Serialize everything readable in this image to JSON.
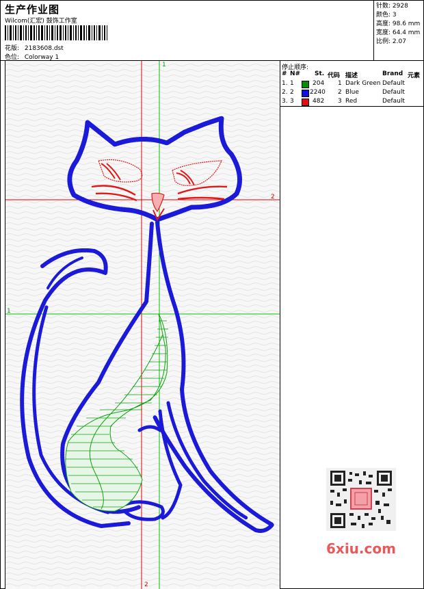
{
  "header": {
    "title": "生产作业图",
    "company": "Wilcom(汇宏) 鼓饰工作室",
    "design_label": "花版:",
    "design_value": "2183608.dst",
    "colorway_label": "色位:",
    "colorway_value": "Colorway 1"
  },
  "stats": {
    "stitches": "针数: 2928",
    "colors": "颜色: 3",
    "height": "高度: 98.6 mm",
    "width": "宽度: 64.4 mm",
    "scale": "比例: 2.07"
  },
  "guides": {
    "v1_label": "1",
    "v2_label": "2",
    "h1_label": "1",
    "h2_label": "2",
    "v1_color": "#00c000",
    "v2_color": "#e00000",
    "h1_color": "#00c000",
    "h2_color": "#e00000"
  },
  "stop_sequence": {
    "heading": "停止顺序:",
    "columns": [
      "#",
      "N#",
      "St.",
      "代码",
      "描述",
      "Brand",
      "元素"
    ],
    "rows": [
      {
        "num": "1.",
        "n": "1",
        "swatch": "#0a8a0a",
        "stitches": "204",
        "code": "1",
        "desc": "Dark Green",
        "brand": "Default"
      },
      {
        "num": "2.",
        "n": "2",
        "swatch": "#1010e0",
        "stitches": "2240",
        "code": "2",
        "desc": "Blue",
        "brand": "Default"
      },
      {
        "num": "3.",
        "n": "3",
        "swatch": "#e01010",
        "stitches": "482",
        "code": "3",
        "desc": "Red",
        "brand": "Default"
      }
    ]
  },
  "watermark": "6xiu.com",
  "colors": {
    "outline": "#1a1ad8",
    "fill": "#10a010",
    "face": "#e01818"
  }
}
